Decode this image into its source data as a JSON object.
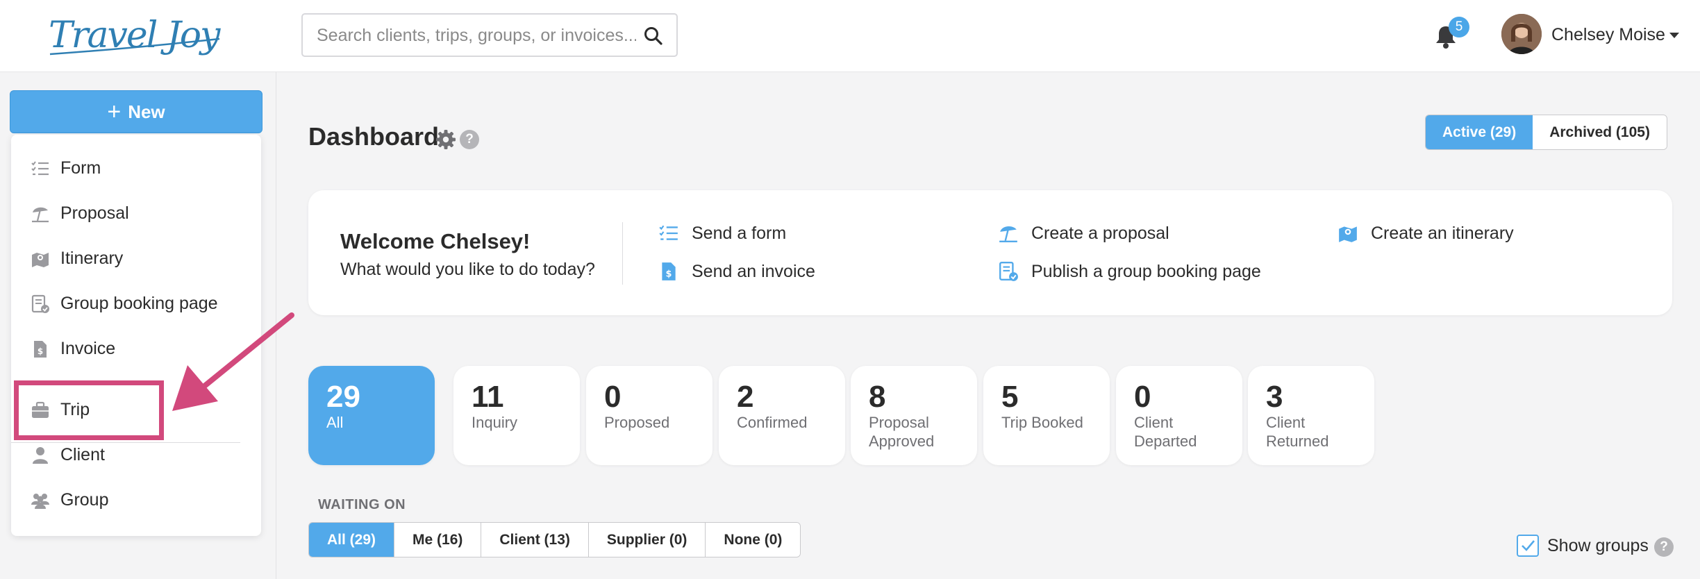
{
  "header": {
    "logo_text": "Travel Joy",
    "search": {
      "placeholder": "Search clients, trips, groups, or invoices...",
      "value": ""
    },
    "notifications": {
      "count": "5"
    },
    "user": {
      "name": "Chelsey Moise"
    }
  },
  "sidebar": {
    "new_button": {
      "icon": "+",
      "label": "New"
    },
    "menu": [
      {
        "label": "Form",
        "icon": "form-checklist-icon"
      },
      {
        "label": "Proposal",
        "icon": "beach-umbrella-icon"
      },
      {
        "label": "Itinerary",
        "icon": "map-icon"
      },
      {
        "label": "Group booking page",
        "icon": "group-booking-icon"
      },
      {
        "label": "Invoice",
        "icon": "invoice-icon"
      },
      {
        "label": "Trip",
        "icon": "briefcase-icon"
      },
      {
        "label": "Client",
        "icon": "person-icon"
      },
      {
        "label": "Group",
        "icon": "people-icon"
      }
    ],
    "highlighted_item": "Trip"
  },
  "main": {
    "title": "Dashboard",
    "help_symbol": "?",
    "view_toggle": [
      {
        "label": "Active (29)",
        "active": true
      },
      {
        "label": "Archived (105)",
        "active": false
      }
    ],
    "welcome": {
      "title": "Welcome Chelsey!",
      "subtitle": "What would you like to do today?",
      "actions": [
        {
          "label": "Send a form",
          "icon": "form-checklist-icon"
        },
        {
          "label": "Create a proposal",
          "icon": "beach-umbrella-icon"
        },
        {
          "label": "Create an itinerary",
          "icon": "map-icon"
        },
        {
          "label": "Send an invoice",
          "icon": "invoice-icon"
        },
        {
          "label": "Publish a group booking page",
          "icon": "group-booking-icon"
        }
      ]
    },
    "stats": [
      {
        "count": "29",
        "label": "All",
        "active": true
      },
      {
        "count": "11",
        "label": "Inquiry",
        "active": false
      },
      {
        "count": "0",
        "label": "Proposed",
        "active": false
      },
      {
        "count": "2",
        "label": "Confirmed",
        "active": false
      },
      {
        "count": "8",
        "label": "Proposal Approved",
        "active": false
      },
      {
        "count": "5",
        "label": "Trip Booked",
        "active": false
      },
      {
        "count": "0",
        "label": "Client Departed",
        "active": false
      },
      {
        "count": "3",
        "label": "Client Returned",
        "active": false
      }
    ],
    "waiting_on": {
      "label": "WAITING ON",
      "filters": [
        {
          "label": "All (29)",
          "active": true
        },
        {
          "label": "Me (16)",
          "active": false
        },
        {
          "label": "Client (13)",
          "active": false
        },
        {
          "label": "Supplier (0)",
          "active": false
        },
        {
          "label": "None (0)",
          "active": false
        }
      ]
    },
    "show_groups": {
      "label": "Show groups",
      "checked": true,
      "help_symbol": "?"
    }
  },
  "colors": {
    "accent": "#52a9ea",
    "annotation": "#d2497c",
    "logo": "#2f7fb3",
    "icon_gray": "#9a9a9e"
  }
}
